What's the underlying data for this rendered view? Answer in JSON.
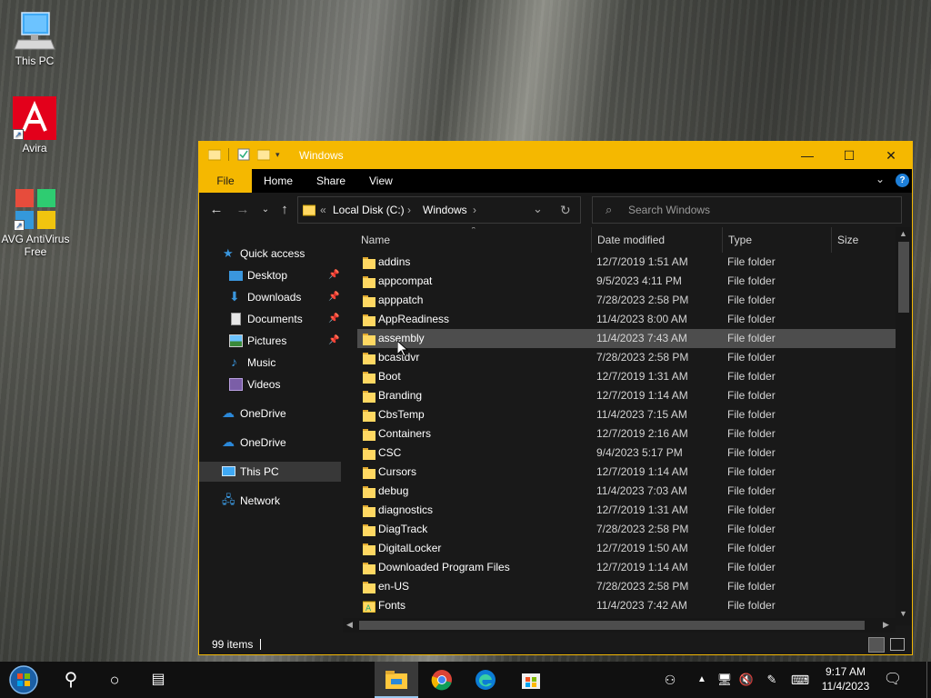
{
  "desktop": {
    "icons": [
      {
        "label": "This PC",
        "icon": "this-pc-icon"
      },
      {
        "label": "Avira",
        "icon": "avira-icon"
      },
      {
        "label": "AVG AntiVirus Free",
        "icon": "avg-antivirus-icon"
      }
    ]
  },
  "window": {
    "title": "Windows",
    "accent": "#f5b800",
    "controls": {
      "minimize": "—",
      "maximize": "☐",
      "close": "✕"
    }
  },
  "ribbon": {
    "tabs": [
      "File",
      "Home",
      "Share",
      "View"
    ],
    "help": "?"
  },
  "address": {
    "overflow": "«",
    "segments": [
      "Local Disk (C:)",
      "Windows"
    ],
    "separator": "›",
    "search_placeholder": "Search Windows"
  },
  "nav": {
    "items": [
      {
        "label": "Quick access",
        "icon": "star-icon",
        "pinned": false
      },
      {
        "label": "Desktop",
        "icon": "desktop-icon",
        "pinned": true
      },
      {
        "label": "Downloads",
        "icon": "download-icon",
        "pinned": true
      },
      {
        "label": "Documents",
        "icon": "documents-icon",
        "pinned": true
      },
      {
        "label": "Pictures",
        "icon": "pictures-icon",
        "pinned": true
      },
      {
        "label": "Music",
        "icon": "music-icon",
        "pinned": false
      },
      {
        "label": "Videos",
        "icon": "videos-icon",
        "pinned": false
      },
      {
        "label": "OneDrive",
        "icon": "onedrive-icon",
        "pinned": false
      },
      {
        "label": "OneDrive",
        "icon": "onedrive-icon",
        "pinned": false
      },
      {
        "label": "This PC",
        "icon": "this-pc-icon",
        "pinned": false,
        "selected": true
      },
      {
        "label": "Network",
        "icon": "network-icon",
        "pinned": false
      }
    ]
  },
  "files": {
    "columns": [
      "Name",
      "Date modified",
      "Type",
      "Size"
    ],
    "rows": [
      {
        "name": "addins",
        "date": "12/7/2019 1:51 AM",
        "type": "File folder"
      },
      {
        "name": "appcompat",
        "date": "9/5/2023 4:11 PM",
        "type": "File folder"
      },
      {
        "name": "apppatch",
        "date": "7/28/2023 2:58 PM",
        "type": "File folder"
      },
      {
        "name": "AppReadiness",
        "date": "11/4/2023 8:00 AM",
        "type": "File folder"
      },
      {
        "name": "assembly",
        "date": "11/4/2023 7:43 AM",
        "type": "File folder",
        "hover": true
      },
      {
        "name": "bcastdvr",
        "date": "7/28/2023 2:58 PM",
        "type": "File folder"
      },
      {
        "name": "Boot",
        "date": "12/7/2019 1:31 AM",
        "type": "File folder"
      },
      {
        "name": "Branding",
        "date": "12/7/2019 1:14 AM",
        "type": "File folder"
      },
      {
        "name": "CbsTemp",
        "date": "11/4/2023 7:15 AM",
        "type": "File folder"
      },
      {
        "name": "Containers",
        "date": "12/7/2019 2:16 AM",
        "type": "File folder"
      },
      {
        "name": "CSC",
        "date": "9/4/2023 5:17 PM",
        "type": "File folder"
      },
      {
        "name": "Cursors",
        "date": "12/7/2019 1:14 AM",
        "type": "File folder"
      },
      {
        "name": "debug",
        "date": "11/4/2023 7:03 AM",
        "type": "File folder"
      },
      {
        "name": "diagnostics",
        "date": "12/7/2019 1:31 AM",
        "type": "File folder"
      },
      {
        "name": "DiagTrack",
        "date": "7/28/2023 2:58 PM",
        "type": "File folder"
      },
      {
        "name": "DigitalLocker",
        "date": "12/7/2019 1:50 AM",
        "type": "File folder"
      },
      {
        "name": "Downloaded Program Files",
        "date": "12/7/2019 1:14 AM",
        "type": "File folder"
      },
      {
        "name": "en-US",
        "date": "7/28/2023 2:58 PM",
        "type": "File folder"
      },
      {
        "name": "Fonts",
        "date": "11/4/2023 7:42 AM",
        "type": "File folder",
        "special": true
      }
    ]
  },
  "status": {
    "count": "99 items"
  },
  "taskbar": {
    "time": "9:17 AM",
    "date": "11/4/2023"
  }
}
